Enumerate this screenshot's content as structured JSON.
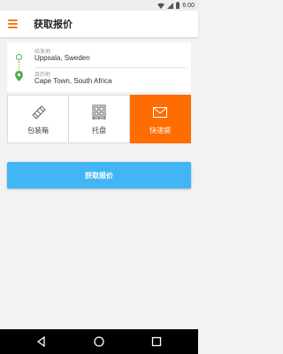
{
  "status_bar": {
    "time": "6:00",
    "icons": [
      "wifi-icon",
      "signal-icon",
      "battery-icon"
    ]
  },
  "app_bar": {
    "title": "获取报价",
    "menu_icon": "hamburger-menu-icon",
    "accent_color": "#f07d1e"
  },
  "origin": {
    "label": "始发地",
    "value": "Uppsala, Sweden",
    "icon": "origin-circle-icon"
  },
  "destination": {
    "label": "目的地",
    "value": "Cape Town, South Africa",
    "icon": "location-pin-icon"
  },
  "package_types": [
    {
      "label": "包装箱",
      "icon": "box-icon",
      "selected": false
    },
    {
      "label": "托盘",
      "icon": "pallet-icon",
      "selected": false
    },
    {
      "label": "快递袋",
      "icon": "envelope-icon",
      "selected": true
    }
  ],
  "selected_color": "#ff6d00",
  "quote_button": {
    "label": "获取报价",
    "color": "#42b6f4"
  },
  "nav_bar": {
    "icons": [
      "back-icon",
      "home-icon",
      "recents-icon"
    ]
  }
}
